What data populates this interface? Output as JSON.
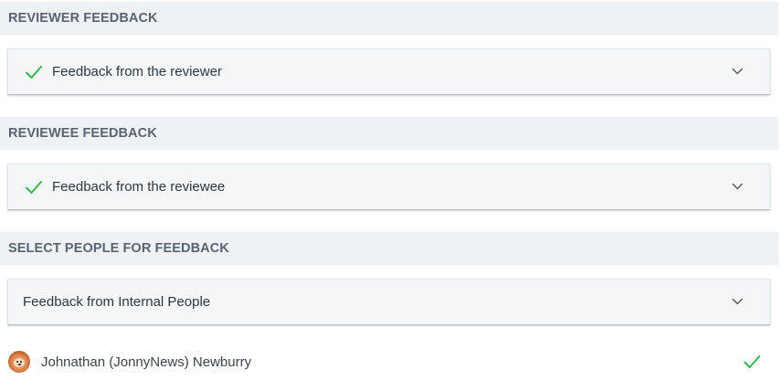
{
  "colors": {
    "check_green": "#3bb34a",
    "header_bg": "#eef2f5",
    "header_text": "#5a6470",
    "accordion_bg": "#f5f6f7",
    "text_dark": "#2d3740"
  },
  "reviewer": {
    "header": "REVIEWER FEEDBACK",
    "accordion_label": "Feedback from the reviewer",
    "status_icon": "check-icon",
    "expand_icon": "chevron-down-icon"
  },
  "reviewee": {
    "header": "REVIEWEE FEEDBACK",
    "accordion_label": "Feedback from the reviewee",
    "status_icon": "check-icon",
    "expand_icon": "chevron-down-icon"
  },
  "select_people": {
    "header": "SELECT PEOPLE FOR FEEDBACK",
    "accordion_label": "Feedback from Internal People",
    "expand_icon": "chevron-down-icon",
    "people": [
      {
        "name": "Johnathan (JonnyNews) Newburry",
        "selected": true,
        "avatar_icon": "avatar-photo",
        "status_icon": "check-icon"
      }
    ]
  }
}
